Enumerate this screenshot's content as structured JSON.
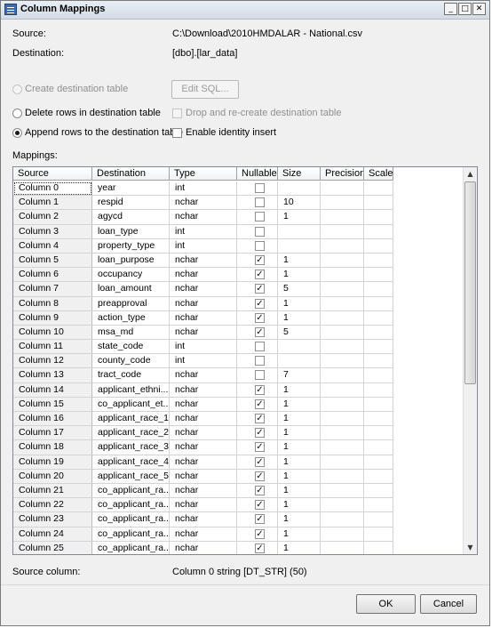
{
  "window": {
    "title": "Column Mappings",
    "controls": {
      "minimize": "_",
      "maximize": "□",
      "close": "✕"
    }
  },
  "source": {
    "label": "Source:",
    "value": "C:\\Download\\2010HMDALAR - National.csv"
  },
  "destination": {
    "label": "Destination:",
    "value": "[dbo].[lar_data]"
  },
  "options": {
    "create_table": "Create destination table",
    "edit_sql": "Edit SQL...",
    "delete_rows": "Delete rows in destination table",
    "drop_recreate": "Drop and re-create destination table",
    "append_rows": "Append rows to the destination table",
    "enable_identity": "Enable identity insert",
    "selected": "append_rows"
  },
  "mappings": {
    "label": "Mappings:",
    "columns": [
      "Source",
      "Destination",
      "Type",
      "Nullable",
      "Size",
      "Precision",
      "Scale"
    ],
    "rows": [
      {
        "source": "Column 0",
        "destination": "year",
        "type": "int",
        "nullable": false,
        "size": ""
      },
      {
        "source": "Column 1",
        "destination": "respid",
        "type": "nchar",
        "nullable": false,
        "size": "10"
      },
      {
        "source": "Column 2",
        "destination": "agycd",
        "type": "nchar",
        "nullable": false,
        "size": "1"
      },
      {
        "source": "Column 3",
        "destination": "loan_type",
        "type": "int",
        "nullable": false,
        "size": ""
      },
      {
        "source": "Column 4",
        "destination": "property_type",
        "type": "int",
        "nullable": false,
        "size": ""
      },
      {
        "source": "Column 5",
        "destination": "loan_purpose",
        "type": "nchar",
        "nullable": true,
        "size": "1"
      },
      {
        "source": "Column 6",
        "destination": "occupancy",
        "type": "nchar",
        "nullable": true,
        "size": "1"
      },
      {
        "source": "Column 7",
        "destination": "loan_amount",
        "type": "nchar",
        "nullable": true,
        "size": "5"
      },
      {
        "source": "Column 8",
        "destination": "preapproval",
        "type": "nchar",
        "nullable": true,
        "size": "1"
      },
      {
        "source": "Column 9",
        "destination": "action_type",
        "type": "nchar",
        "nullable": true,
        "size": "1"
      },
      {
        "source": "Column 10",
        "destination": "msa_md",
        "type": "nchar",
        "nullable": true,
        "size": "5"
      },
      {
        "source": "Column 11",
        "destination": "state_code",
        "type": "int",
        "nullable": false,
        "size": ""
      },
      {
        "source": "Column 12",
        "destination": "county_code",
        "type": "int",
        "nullable": false,
        "size": ""
      },
      {
        "source": "Column 13",
        "destination": "tract_code",
        "type": "nchar",
        "nullable": false,
        "size": "7"
      },
      {
        "source": "Column 14",
        "destination": "applicant_ethni...",
        "type": "nchar",
        "nullable": true,
        "size": "1"
      },
      {
        "source": "Column 15",
        "destination": "co_applicant_et...",
        "type": "nchar",
        "nullable": true,
        "size": "1"
      },
      {
        "source": "Column 16",
        "destination": "applicant_race_1",
        "type": "nchar",
        "nullable": true,
        "size": "1"
      },
      {
        "source": "Column 17",
        "destination": "applicant_race_2",
        "type": "nchar",
        "nullable": true,
        "size": "1"
      },
      {
        "source": "Column 18",
        "destination": "applicant_race_3",
        "type": "nchar",
        "nullable": true,
        "size": "1"
      },
      {
        "source": "Column 19",
        "destination": "applicant_race_4",
        "type": "nchar",
        "nullable": true,
        "size": "1"
      },
      {
        "source": "Column 20",
        "destination": "applicant_race_5",
        "type": "nchar",
        "nullable": true,
        "size": "1"
      },
      {
        "source": "Column 21",
        "destination": "co_applicant_ra...",
        "type": "nchar",
        "nullable": true,
        "size": "1"
      },
      {
        "source": "Column 22",
        "destination": "co_applicant_ra...",
        "type": "nchar",
        "nullable": true,
        "size": "1"
      },
      {
        "source": "Column 23",
        "destination": "co_applicant_ra...",
        "type": "nchar",
        "nullable": true,
        "size": "1"
      },
      {
        "source": "Column 24",
        "destination": "co_applicant_ra...",
        "type": "nchar",
        "nullable": true,
        "size": "1"
      },
      {
        "source": "Column 25",
        "destination": "co_applicant_ra...",
        "type": "nchar",
        "nullable": true,
        "size": "1"
      }
    ]
  },
  "source_column": {
    "label": "Source column:",
    "value": "Column 0 string [DT_STR] (50)"
  },
  "buttons": {
    "ok": "OK",
    "cancel": "Cancel"
  }
}
